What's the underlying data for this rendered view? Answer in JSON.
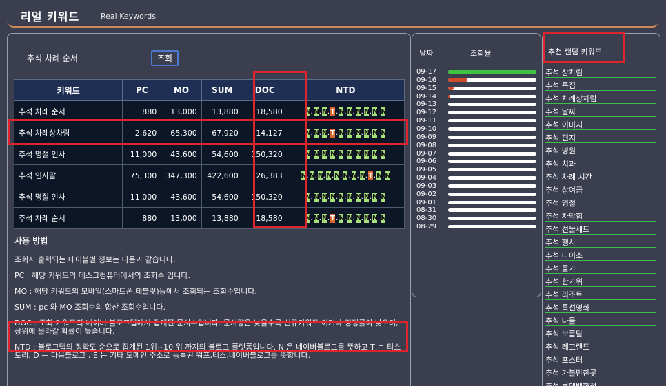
{
  "header": {
    "title": "리얼 키워드",
    "subtitle": "Real Keywords"
  },
  "search": {
    "value": "추석 차례 순서",
    "button_label": "조회"
  },
  "table": {
    "headers": [
      "키워드",
      "PC",
      "MO",
      "SUM",
      "DOC",
      "NTD"
    ],
    "rows": [
      {
        "keyword": "추석 차례 순서",
        "pc": "880",
        "mo": "13,000",
        "sum": "13,880",
        "doc": "18,580",
        "ntd": "NNNTNNNNNN"
      },
      {
        "keyword": "추석 차례상차림",
        "pc": "2,620",
        "mo": "65,300",
        "sum": "67,920",
        "doc": "14,127",
        "ntd": "NNNTNNNNNN"
      },
      {
        "keyword": "추석 명절 인사",
        "pc": "11,000",
        "mo": "43,600",
        "sum": "54,600",
        "doc": "150,320",
        "ntd": "NNNNNNNNNN"
      },
      {
        "keyword": "추석 인사말",
        "pc": "75,300",
        "mo": "347,300",
        "sum": "422,600",
        "doc": "26,383",
        "ntd": "NNNNNNNNTNN"
      },
      {
        "keyword": "추석 명절 인사",
        "pc": "11,000",
        "mo": "43,600",
        "sum": "54,600",
        "doc": "150,320",
        "ntd": "NNNNNNNNNN"
      },
      {
        "keyword": "추석 차례 순서",
        "pc": "880",
        "mo": "13,000",
        "sum": "13,880",
        "doc": "18,580",
        "ntd": "NNNTNNNNNN"
      }
    ]
  },
  "usage": {
    "title": "사용 방법",
    "lines": [
      "조회시 출력되는 테이블별 정보는 다음과 같습니다.",
      "PC : 해당 키워드의 데스크컴퓨터에서의 조회수 입니다.",
      "MO : 해당 키워드의 모바일(스마트폰,테블릿)등에서 조회되는 조회수입니다.",
      "SUM : pc 와 MO 조회수의 합산 조회수입니다.",
      "DOC : 조회 키워드의 네이버 블로그탭에서 집계된 문서수입니다. 문서량은 낮을수록 신규키워드 이거나 경쟁률이 낮으며, 상위에 올라갈 확률이 높습니다.",
      "NTD : 블로그탭의 정확도 순으로 집계된 1위~10 위 까지의 블로그 플랫폼입니다. N 은 네이버블로그를 뜻하고 T 는 티스토리, D 는 다음블로그 , E 는 기타 도메인 주소로 등록된 워프,티스,네이버블로그를 뜻합니다."
    ]
  },
  "dates": {
    "header_date": "날짜",
    "header_rate": "조회율",
    "rows": [
      {
        "date": "09-17",
        "level": 1.0,
        "color": "#3ec43e"
      },
      {
        "date": "09-16",
        "level": 0.22,
        "color": "#d04a2a"
      },
      {
        "date": "09-15",
        "level": 0.06,
        "color": "#d04a2a"
      },
      {
        "date": "09-14",
        "level": 0.02,
        "color": "#d04a2a"
      },
      {
        "date": "09-13",
        "level": 0,
        "color": "#d04a2a"
      },
      {
        "date": "09-12",
        "level": 0,
        "color": "#d04a2a"
      },
      {
        "date": "09-11",
        "level": 0,
        "color": "#d04a2a"
      },
      {
        "date": "09-10",
        "level": 0,
        "color": "#d04a2a"
      },
      {
        "date": "09-09",
        "level": 0,
        "color": "#d04a2a"
      },
      {
        "date": "09-08",
        "level": 0,
        "color": "#d04a2a"
      },
      {
        "date": "09-07",
        "level": 0,
        "color": "#d04a2a"
      },
      {
        "date": "09-06",
        "level": 0,
        "color": "#d04a2a"
      },
      {
        "date": "09-05",
        "level": 0,
        "color": "#d04a2a"
      },
      {
        "date": "09-04",
        "level": 0,
        "color": "#d04a2a"
      },
      {
        "date": "09-03",
        "level": 0,
        "color": "#d04a2a"
      },
      {
        "date": "09-02",
        "level": 0,
        "color": "#d04a2a"
      },
      {
        "date": "09-01",
        "level": 0,
        "color": "#d04a2a"
      },
      {
        "date": "08-31",
        "level": 0,
        "color": "#d04a2a"
      },
      {
        "date": "08-30",
        "level": 0,
        "color": "#d04a2a"
      },
      {
        "date": "08-29",
        "level": 0,
        "color": "#d04a2a"
      }
    ]
  },
  "recommend": {
    "title": "추천 랜덤 키워드",
    "items": [
      "추석 상차림",
      "추석 특집",
      "추석 차례상차림",
      "추석 날짜",
      "추석 이미지",
      "추석 편지",
      "추석 병원",
      "추석 치과",
      "추석 차례 시간",
      "추석 상여금",
      "추석 명절",
      "추석 차막힘",
      "추석 선물세트",
      "추석 행사",
      "추석 다이소",
      "추석 물가",
      "추석 한가위",
      "추석 리조트",
      "추석 특선영화",
      "추석 나물",
      "추석 보름달",
      "추석 레고랜드",
      "추석 포스터",
      "추석 가볼만한곳",
      "추석 롯데백화점"
    ]
  },
  "colors": {
    "background": "#3a3e4f",
    "highlight": "#e0242c",
    "ntd_n": "#a6e07a",
    "ntd_t": "#d8662e",
    "underline": "#3dbd4a"
  }
}
